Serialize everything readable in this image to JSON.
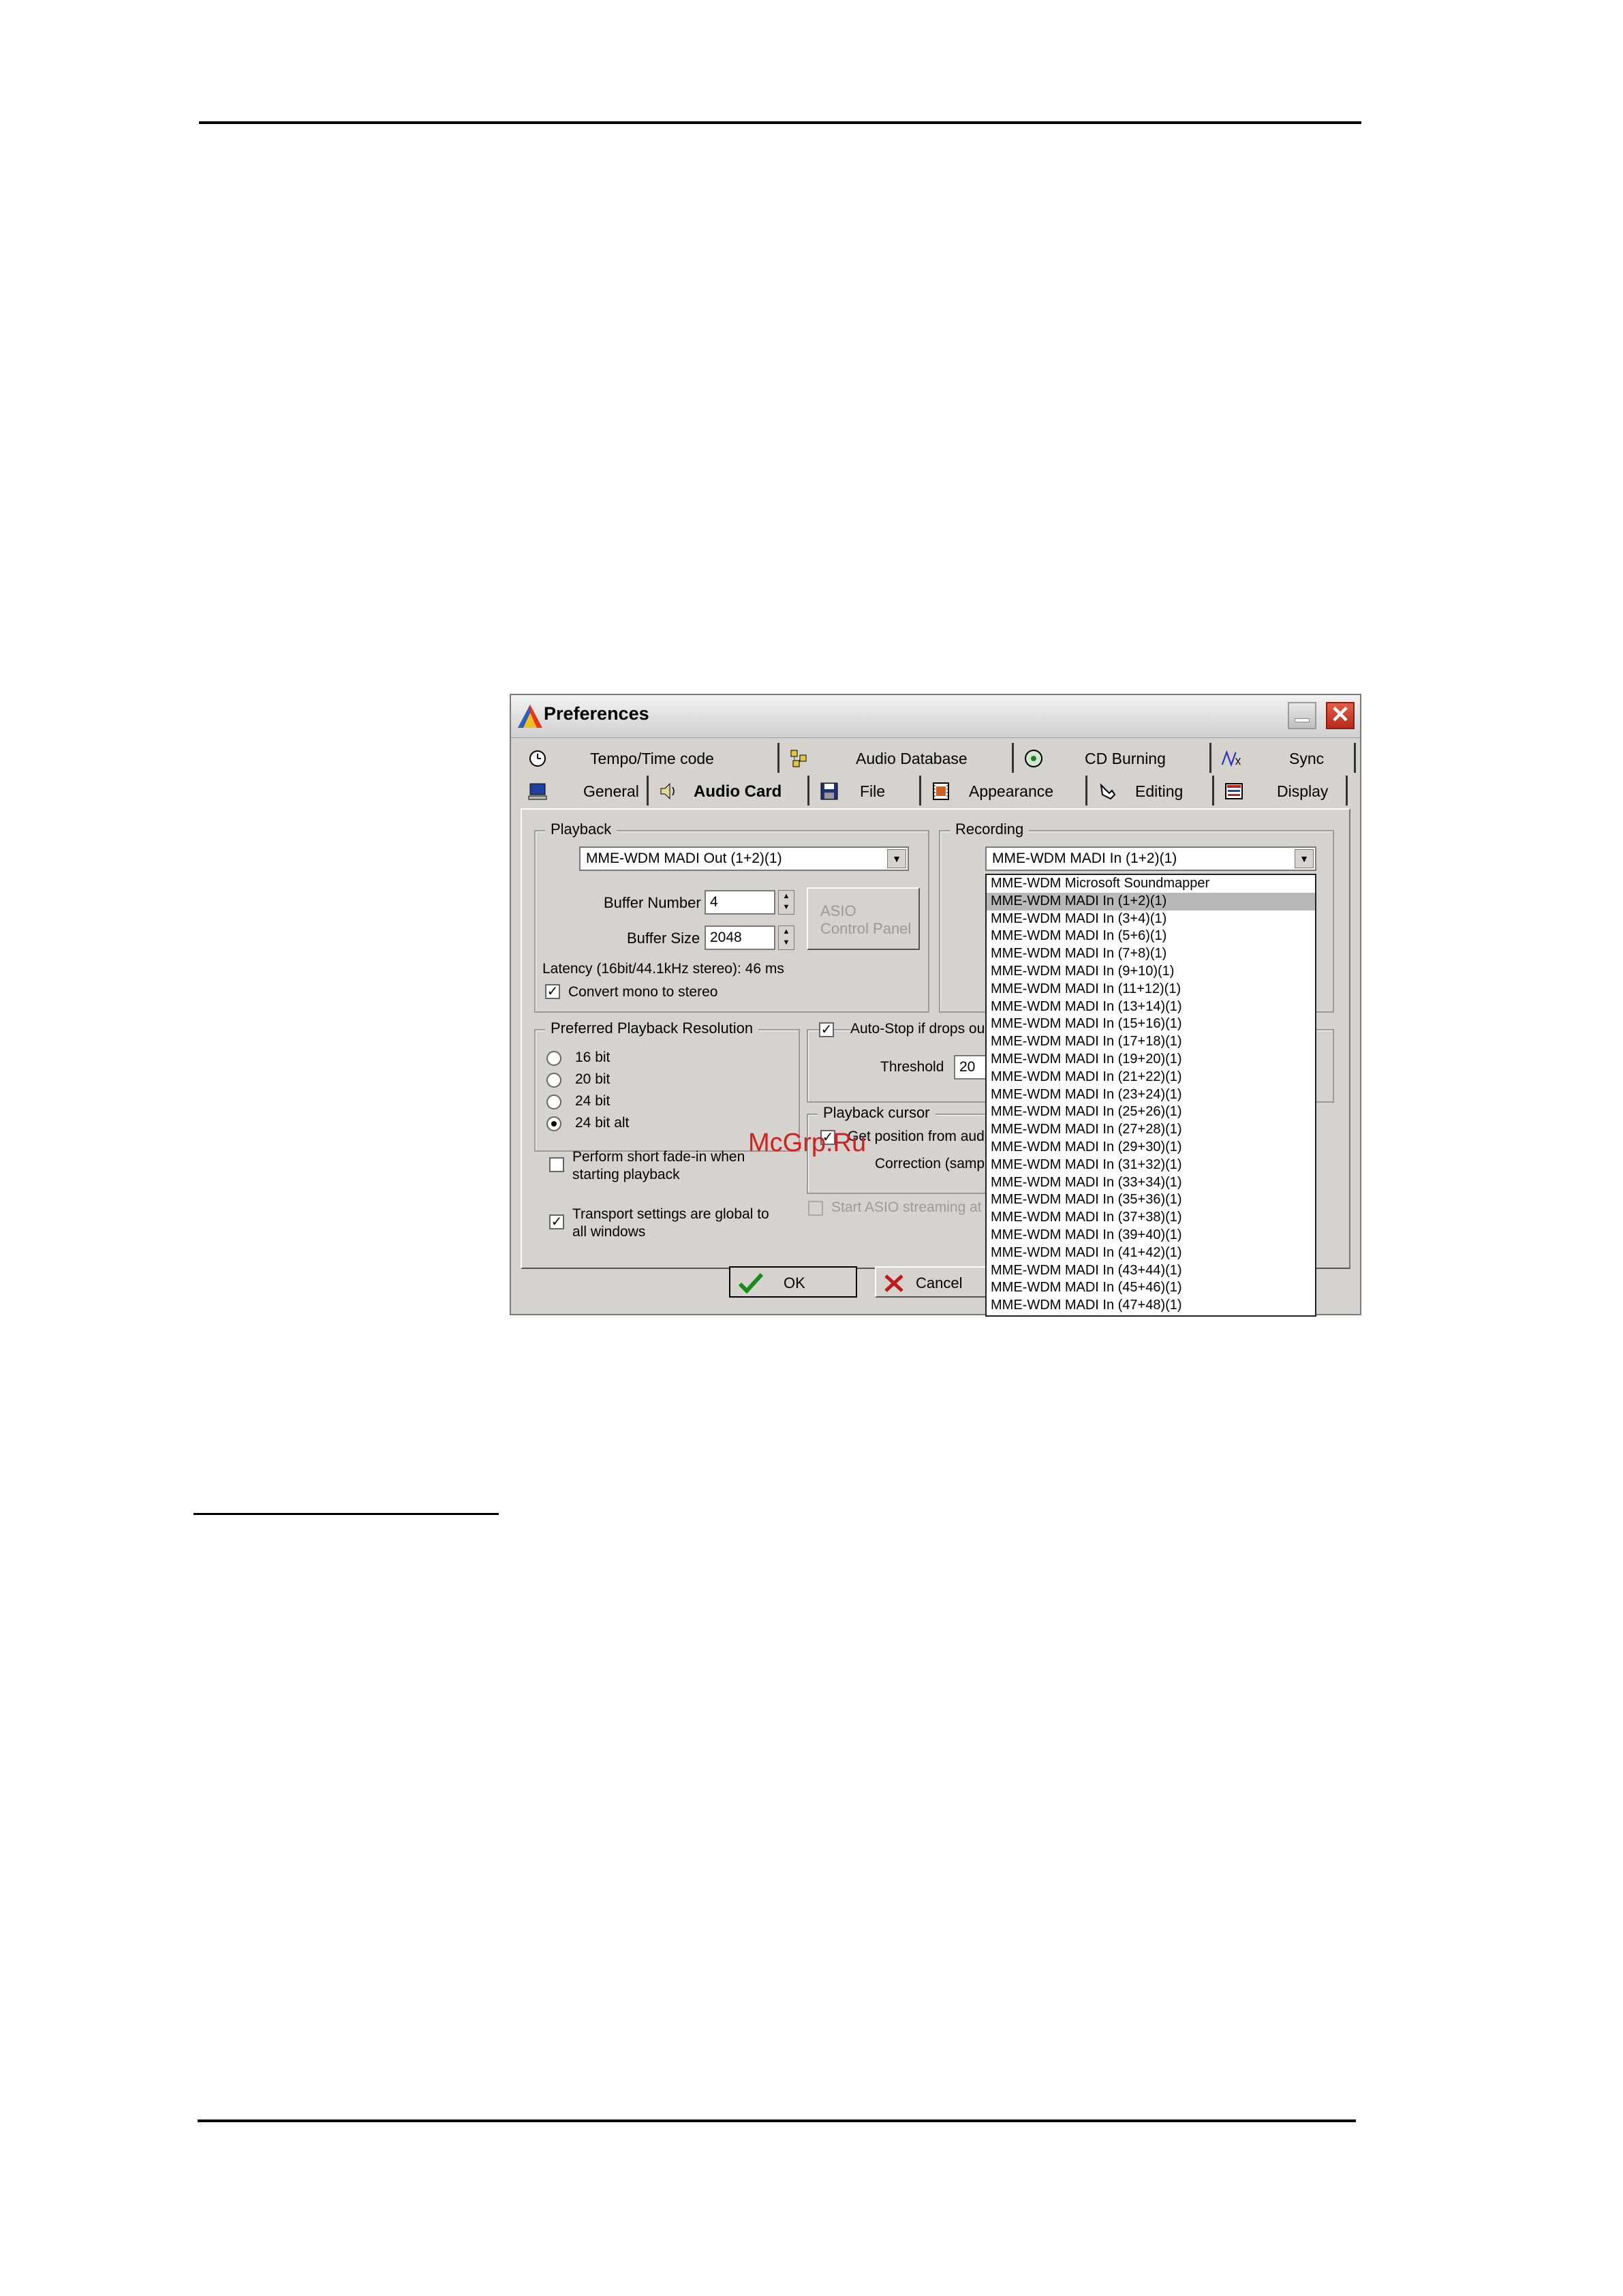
{
  "dialog": {
    "title": "Preferences",
    "close_glyph": "✕"
  },
  "tabs_row1": [
    {
      "label": "Tempo/Time code",
      "icon": "clock-icon"
    },
    {
      "label": "Audio Database",
      "icon": "database-icon"
    },
    {
      "label": "CD Burning",
      "icon": "cd-icon"
    },
    {
      "label": "Sync",
      "icon": "sync-wave-icon"
    }
  ],
  "tabs_row2": [
    {
      "label": "General",
      "icon": "computer-icon"
    },
    {
      "label": "Audio Card",
      "icon": "speaker-icon",
      "active": true
    },
    {
      "label": "File",
      "icon": "floppy-icon"
    },
    {
      "label": "Appearance",
      "icon": "film-icon"
    },
    {
      "label": "Editing",
      "icon": "hand-icon"
    },
    {
      "label": "Display",
      "icon": "display-icon"
    }
  ],
  "playback": {
    "title": "Playback",
    "device": "MME-WDM MADI Out (1+2)(1)",
    "buffer_number_label": "Buffer Number",
    "buffer_number": "4",
    "buffer_size_label": "Buffer Size",
    "buffer_size": "2048",
    "asio_line1": "ASIO",
    "asio_line2": "Control Panel",
    "latency": "Latency (16bit/44.1kHz stereo): 46 ms",
    "convert_mono": "Convert mono to stereo",
    "convert_mono_checked": true
  },
  "recording": {
    "title": "Recording",
    "device": "MME-WDM MADI In (1+2)(1)"
  },
  "resolution": {
    "title": "Preferred Playback Resolution",
    "options": [
      "16 bit",
      "20 bit",
      "24 bit",
      "24 bit alt"
    ],
    "selected_index": 3
  },
  "autostop": {
    "label": "Auto-Stop if drops ou",
    "checked": true,
    "threshold_label": "Threshold",
    "threshold": "20"
  },
  "cursor": {
    "title": "Playback cursor",
    "get_position": "Get position from audi",
    "get_position_checked": true,
    "correction": "Correction (sampl"
  },
  "fade": {
    "line1": "Perform short fade-in when",
    "line2": "starting playback",
    "checked": false
  },
  "transport": {
    "line1": "Transport settings are global to",
    "line2": "all windows",
    "checked": true
  },
  "asio_stream": {
    "label": "Start ASIO streaming at",
    "checked": false
  },
  "buttons": {
    "ok": "OK",
    "cancel": "Cancel"
  },
  "dropdown_items": [
    "MME-WDM Microsoft Soundmapper",
    "MME-WDM MADI In (1+2)(1)",
    "MME-WDM MADI In (3+4)(1)",
    "MME-WDM MADI In (5+6)(1)",
    "MME-WDM MADI In (7+8)(1)",
    "MME-WDM MADI In (9+10)(1)",
    "MME-WDM MADI In (11+12)(1)",
    "MME-WDM MADI In (13+14)(1)",
    "MME-WDM MADI In (15+16)(1)",
    "MME-WDM MADI In (17+18)(1)",
    "MME-WDM MADI In (19+20)(1)",
    "MME-WDM MADI In (21+22)(1)",
    "MME-WDM MADI In (23+24)(1)",
    "MME-WDM MADI In (25+26)(1)",
    "MME-WDM MADI In (27+28)(1)",
    "MME-WDM MADI In (29+30)(1)",
    "MME-WDM MADI In (31+32)(1)",
    "MME-WDM MADI In (33+34)(1)",
    "MME-WDM MADI In (35+36)(1)",
    "MME-WDM MADI In (37+38)(1)",
    "MME-WDM MADI In (39+40)(1)",
    "MME-WDM MADI In (41+42)(1)",
    "MME-WDM MADI In (43+44)(1)",
    "MME-WDM MADI In (45+46)(1)",
    "MME-WDM MADI In (47+48)(1)"
  ],
  "dropdown_selected_index": 1,
  "watermark": "McGrp.Ru"
}
